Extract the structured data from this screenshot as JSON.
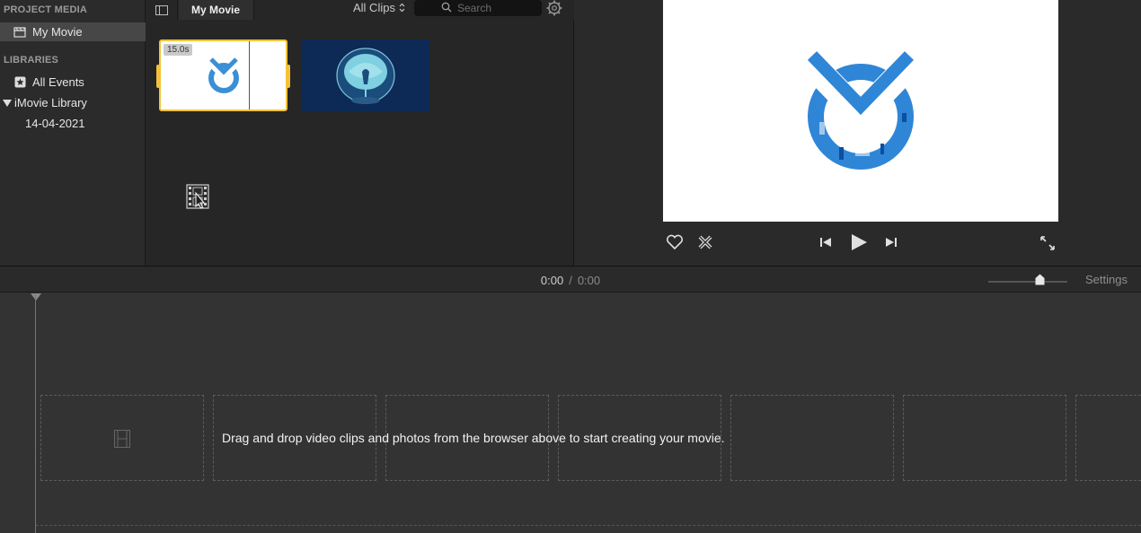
{
  "sidebar": {
    "project_media_header": "PROJECT MEDIA",
    "project_item": "My Movie",
    "libraries_header": "LIBRARIES",
    "all_events": "All Events",
    "library_name": "iMovie Library",
    "event_date": "14-04-2021"
  },
  "browser": {
    "title_tab": "My Movie",
    "filter_label": "All Clips",
    "search_placeholder": "Search",
    "clips": [
      {
        "duration_badge": "15.0s",
        "selected": true
      },
      {
        "duration_badge": "",
        "selected": false
      }
    ]
  },
  "viewer": {
    "favorite_icon": "heart-icon",
    "reject_icon": "reject-x-icon",
    "prev_icon": "skip-back-icon",
    "play_icon": "play-icon",
    "next_icon": "skip-forward-icon",
    "fullscreen_icon": "fullscreen-icon"
  },
  "timeline": {
    "current_time": "0:00",
    "separator": "/",
    "duration": "0:00",
    "settings_label": "Settings",
    "drop_message": "Drag and drop video clips and photos from the browser above to start creating your movie."
  },
  "colors": {
    "selection_yellow": "#f3c23a",
    "logo_blue": "#2f86d6",
    "clip2_bg": "#0c2a55"
  }
}
